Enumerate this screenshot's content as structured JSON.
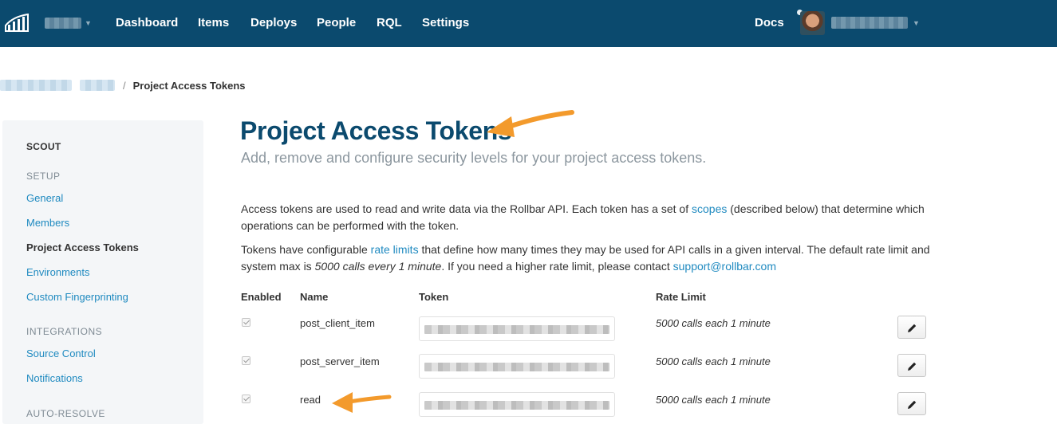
{
  "nav": {
    "items": [
      "Dashboard",
      "Items",
      "Deploys",
      "People",
      "RQL",
      "Settings"
    ],
    "docs": "Docs"
  },
  "breadcrumb": {
    "separator": "/",
    "current": "Project Access Tokens"
  },
  "sidebar": {
    "project": "SCOUT",
    "sections": [
      {
        "title": "SETUP",
        "items": [
          "General",
          "Members",
          "Project Access Tokens",
          "Environments",
          "Custom Fingerprinting"
        ]
      },
      {
        "title": "INTEGRATIONS",
        "items": [
          "Source Control",
          "Notifications"
        ]
      },
      {
        "title": "AUTO-RESOLVE",
        "items": []
      }
    ],
    "active_item": "Project Access Tokens"
  },
  "main": {
    "title": "Project Access Tokens",
    "subtitle": "Add, remove and configure security levels for your project access tokens.",
    "intro": {
      "p1_before": "Access tokens are used to read and write data via the Rollbar API. Each token has a set of ",
      "p1_link": "scopes",
      "p1_after": " (described below) that determine which operations can be performed with the token.",
      "p2_before": "Tokens have configurable ",
      "p2_link": "rate limits",
      "p2_mid": " that define how many times they may be used for API calls in a given interval. The default rate limit and system max is ",
      "p2_em": "5000 calls every 1 minute",
      "p2_after": ". If you need a higher rate limit, please contact ",
      "p2_email": "support@rollbar.com"
    },
    "table": {
      "headers": [
        "Enabled",
        "Name",
        "Token",
        "Rate Limit"
      ],
      "rows": [
        {
          "enabled": true,
          "name": "post_client_item",
          "rate_limit": "5000 calls each 1 minute"
        },
        {
          "enabled": true,
          "name": "post_server_item",
          "rate_limit": "5000 calls each 1 minute"
        },
        {
          "enabled": true,
          "name": "read",
          "rate_limit": "5000 calls each 1 minute"
        }
      ]
    }
  },
  "colors": {
    "nav_bg": "#0b4a6e",
    "link": "#1f8ac0",
    "title": "#0b4a6e",
    "annotation_arrow": "#f39a2c"
  },
  "icons": [
    "rollbar-logo-icon",
    "chevron-down-icon",
    "pencil-icon",
    "arrow-annotation-icon"
  ]
}
